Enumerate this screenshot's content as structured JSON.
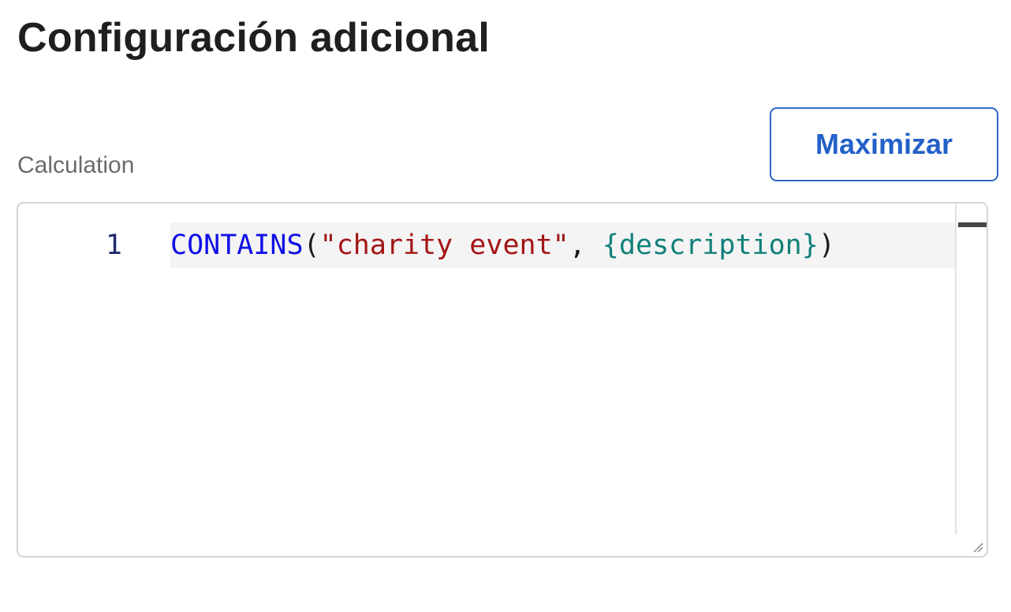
{
  "header": {
    "title": "Configuración adicional"
  },
  "toolbar": {
    "maximize_label": "Maximizar"
  },
  "calculation": {
    "label": "Calculation",
    "editor": {
      "lines": [
        {
          "number": "1",
          "tokens": {
            "function": "CONTAINS",
            "open_paren": "(",
            "string": "\"charity event\"",
            "comma": ", ",
            "field": "{description}",
            "close_paren": ")"
          }
        }
      ]
    }
  },
  "colors": {
    "title": "#1f1f1f",
    "accent": "#2361c9",
    "function_token": "#1010e6",
    "string_token": "#a31515",
    "field_token": "#12807a",
    "label": "#6b6b6b"
  }
}
